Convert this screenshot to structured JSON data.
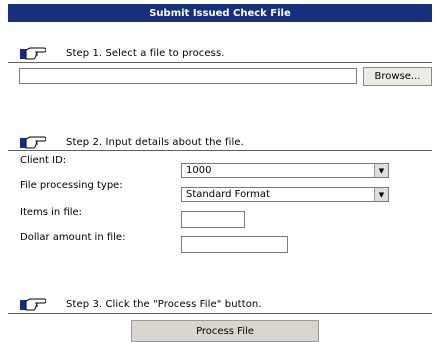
{
  "title": "Submit Issued Check File",
  "step1": {
    "text": "Step 1.  Select a file to process.",
    "file_value": "",
    "browse_label": "Browse..."
  },
  "step2": {
    "text": "Step 2.  Input details about the file.",
    "client_id_label": "Client ID:",
    "client_id_value": "1000",
    "processing_type_label": "File processing type:",
    "processing_type_value": "Standard Format",
    "items_label": "Items in file:",
    "items_value": "",
    "dollar_label": "Dollar amount in file:",
    "dollar_value": ""
  },
  "step3": {
    "text": "Step 3.  Click the \"Process File\" button.",
    "button_label": "Process File"
  },
  "icons": {
    "step": "pointing-hand-icon",
    "dropdown": "chevron-down-icon"
  },
  "colors": {
    "title_bg": "#16307e",
    "title_text": "#ffffff",
    "hand": "#1c2b8a"
  }
}
